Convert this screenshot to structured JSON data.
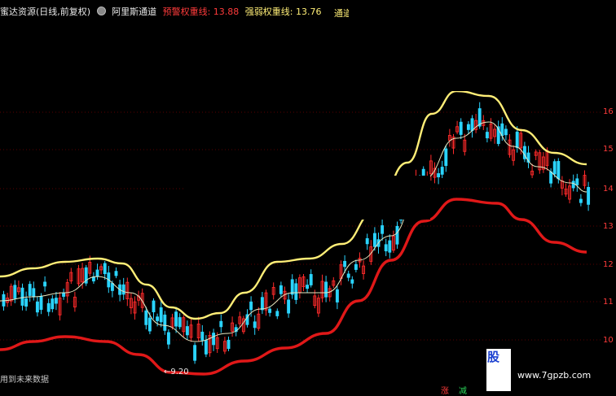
{
  "header": {
    "title": "蜜达资源(日线,前复权)",
    "indicator_name": "阿里斯通道",
    "line1_label": "预警权重线: 13.88",
    "line2_label": "强弱权重线: 13.76",
    "right_label": "通道"
  },
  "right_axis_labels": [
    "16",
    "15",
    "14",
    "13",
    "12",
    "11",
    "10"
  ],
  "low_marker": "9.20",
  "footer": {
    "left_text": "用到未来数据",
    "tab_up": "涨",
    "tab_down": "减"
  },
  "watermark": {
    "logo_text": "股",
    "url": "www.7gpzb.com"
  },
  "colors": {
    "background": "#000000",
    "up": "#ff2a2a",
    "down": "#2ad4ff",
    "upper_band": "#ffee77",
    "lower_band": "#e01818",
    "mid_line": "#e8e8c0"
  }
}
